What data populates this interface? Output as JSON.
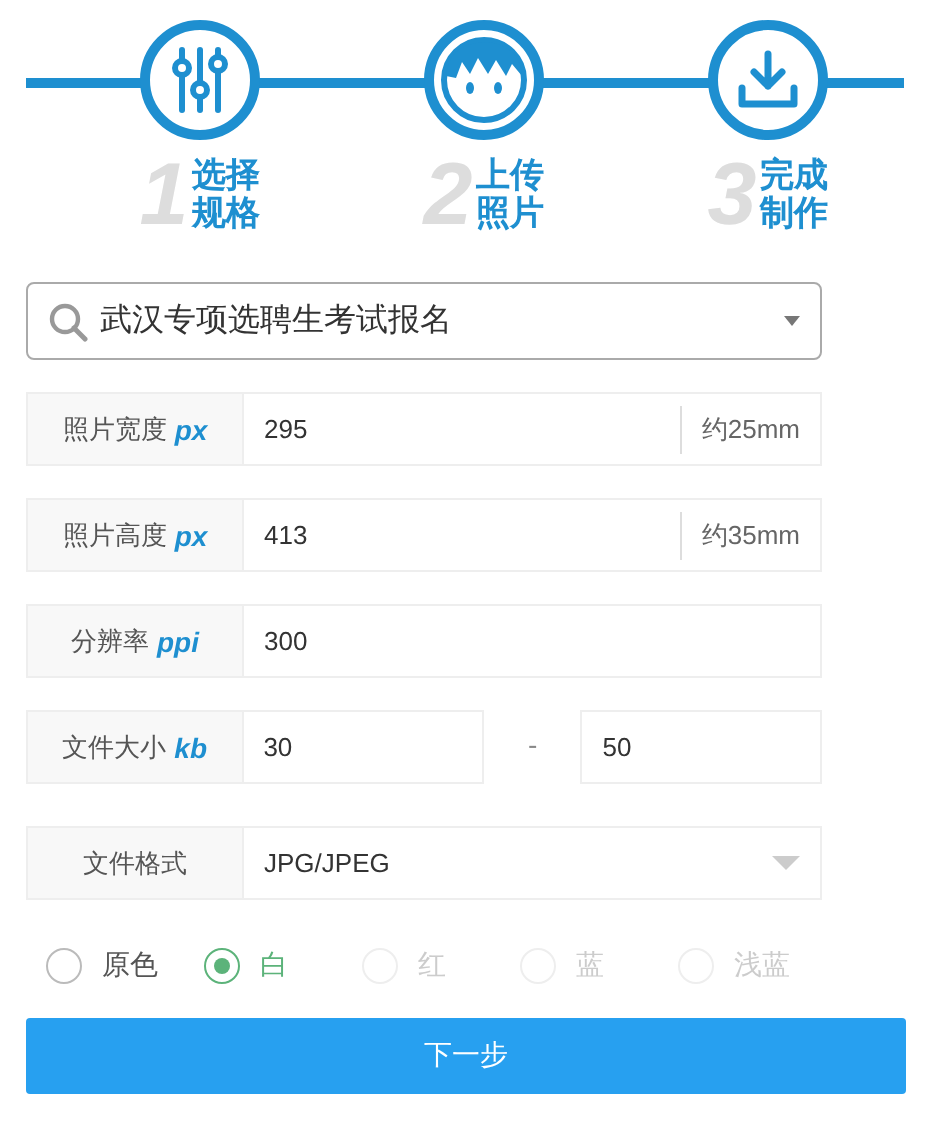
{
  "steps": [
    {
      "number": "1",
      "line1": "选择",
      "line2": "规格"
    },
    {
      "number": "2",
      "line1": "上传",
      "line2": "照片"
    },
    {
      "number": "3",
      "line1": "完成",
      "line2": "制作"
    }
  ],
  "search": {
    "value": "武汉专项选聘生考试报名"
  },
  "fields": [
    {
      "kind": "suffix",
      "label": "照片宽度",
      "unit": "px",
      "value": "295",
      "note": "约25mm"
    },
    {
      "kind": "suffix",
      "label": "照片高度",
      "unit": "px",
      "value": "413",
      "note": "约35mm"
    },
    {
      "kind": "plain",
      "label": "分辨率",
      "unit": "ppi",
      "value": "300"
    },
    {
      "kind": "range",
      "label": "文件大小",
      "unit": "kb",
      "value": "30",
      "separator": "-",
      "value2": "50"
    },
    {
      "kind": "select",
      "label": "文件格式",
      "value": "JPG/JPEG"
    }
  ],
  "backgrounds": [
    {
      "label": "原色",
      "selected": false,
      "disabled": false
    },
    {
      "label": "白",
      "selected": true,
      "disabled": false
    },
    {
      "label": "红",
      "selected": false,
      "disabled": true
    },
    {
      "label": "蓝",
      "selected": false,
      "disabled": true
    },
    {
      "label": "浅蓝",
      "selected": false,
      "disabled": true
    }
  ],
  "next_button": "下一步"
}
